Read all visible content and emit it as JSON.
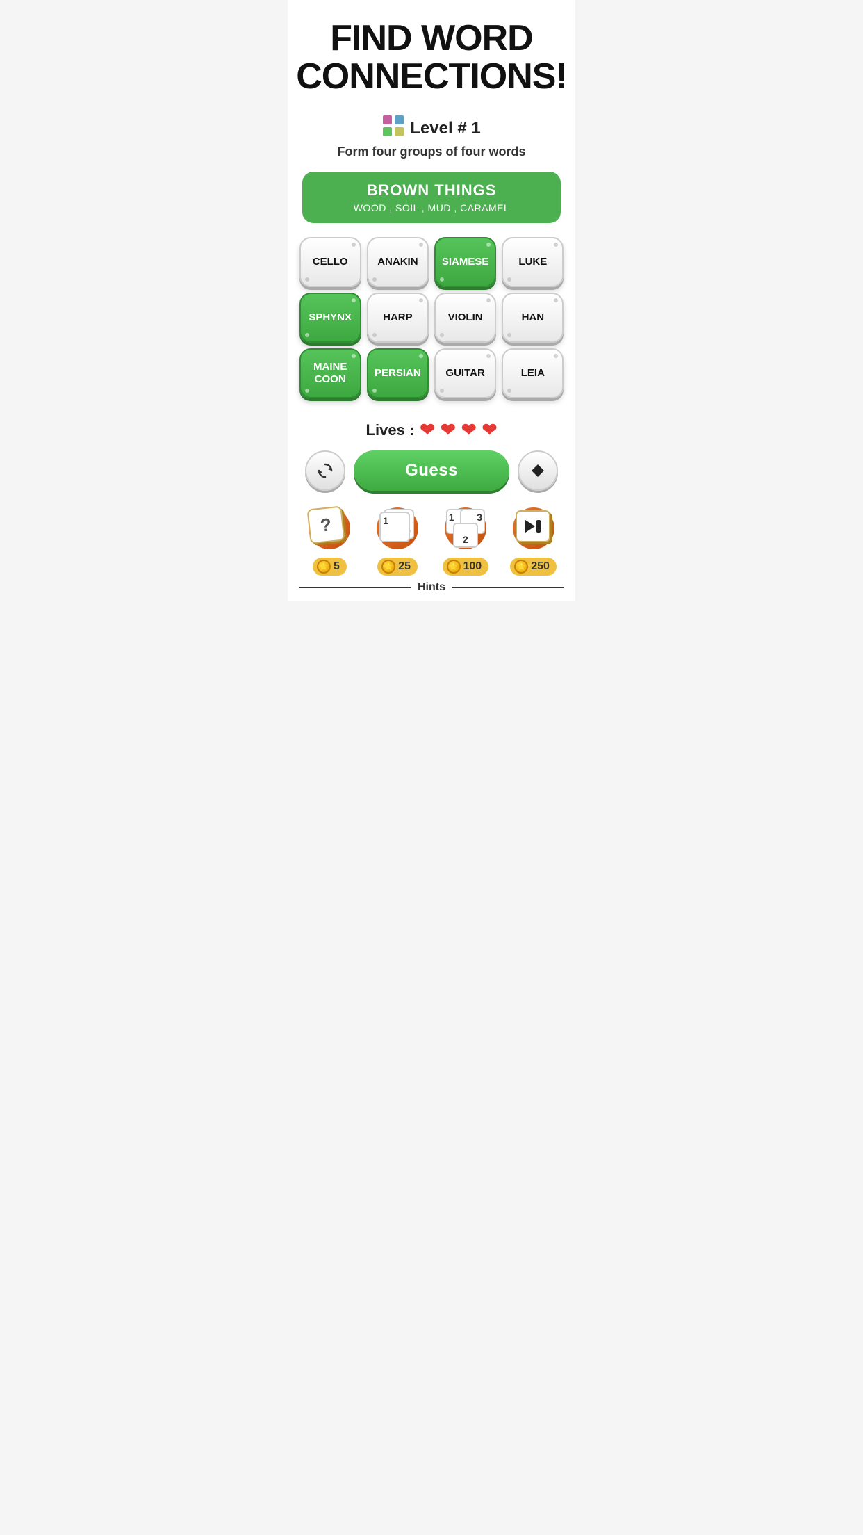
{
  "title": {
    "line1": "FIND WORD",
    "line2": "CONNECTIONS!"
  },
  "level": {
    "icon": "🎮",
    "label": "Level # 1",
    "subtitle": "Form four groups of four words"
  },
  "solved_group": {
    "title": "BROWN THINGS",
    "words": "WOOD , SOIL , MUD , CARAMEL"
  },
  "grid": [
    [
      {
        "word": "CELLO",
        "state": "normal"
      },
      {
        "word": "ANAKIN",
        "state": "normal"
      },
      {
        "word": "SIAMESE",
        "state": "selected"
      },
      {
        "word": "LUKE",
        "state": "normal"
      }
    ],
    [
      {
        "word": "SPHYNX",
        "state": "selected"
      },
      {
        "word": "HARP",
        "state": "normal"
      },
      {
        "word": "VIOLIN",
        "state": "normal"
      },
      {
        "word": "HAN",
        "state": "normal"
      }
    ],
    [
      {
        "word": "MAINE\nCOON",
        "state": "selected"
      },
      {
        "word": "PERSIAN",
        "state": "selected"
      },
      {
        "word": "GUITAR",
        "state": "normal"
      },
      {
        "word": "LEIA",
        "state": "normal"
      }
    ]
  ],
  "lives": {
    "label": "Lives :",
    "count": 4
  },
  "buttons": {
    "shuffle": "↺",
    "guess": "Guess",
    "erase": "◆"
  },
  "hints": [
    {
      "type": "question",
      "cost": "5"
    },
    {
      "type": "reveal-one",
      "cost": "25"
    },
    {
      "type": "reveal-all",
      "cost": "100"
    },
    {
      "type": "skip",
      "cost": "250"
    }
  ],
  "hints_label": "Hints"
}
